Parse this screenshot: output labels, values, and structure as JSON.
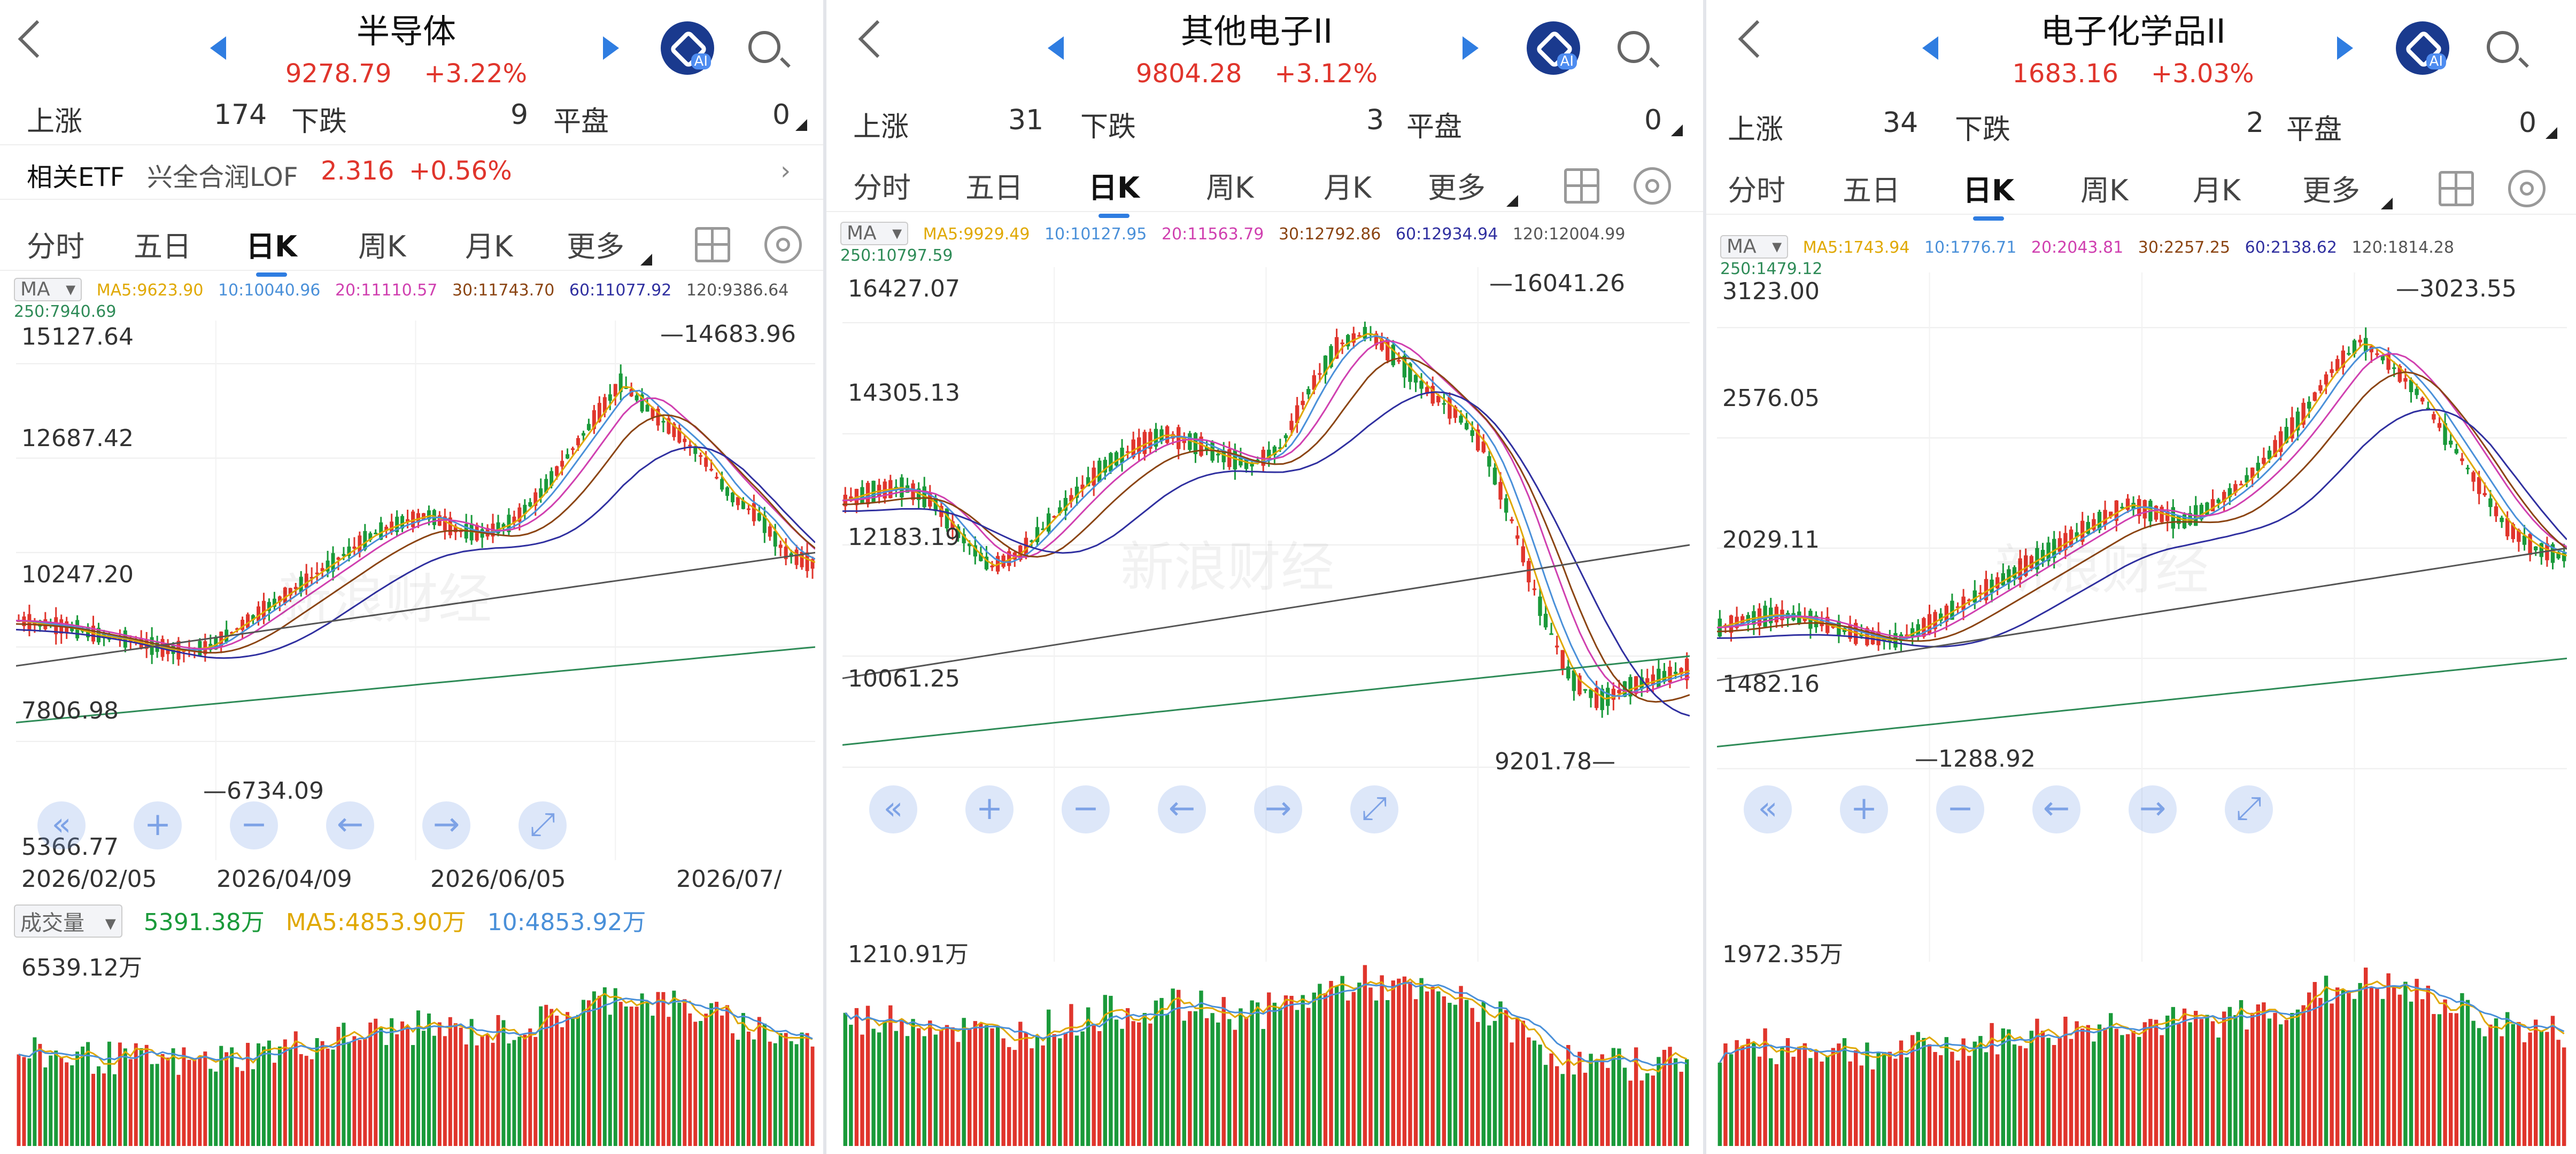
{
  "colors": {
    "up": "#e0352c",
    "down": "#1a9a3a",
    "accent": "#2f7de1",
    "ma5": "#e0a800",
    "ma10": "#4a90d9",
    "ma20": "#d040b0",
    "ma30": "#8b4513",
    "ma60": "#3030a0",
    "ma120": "#555555",
    "ma250": "#2e8b57"
  },
  "panels": [
    {
      "title": "半导体",
      "price": "9278.79",
      "change": "+3.22%",
      "stats": {
        "up_label": "上涨",
        "up": "174",
        "down_label": "下跌",
        "down": "9",
        "flat_label": "平盘",
        "flat": "0"
      },
      "etf": {
        "label": "相关ETF",
        "name": "兴全合润LOF",
        "price": "2.316",
        "change": "+0.56%"
      },
      "tabs": [
        "分时",
        "五日",
        "日K",
        "周K",
        "月K",
        "更多"
      ],
      "active_tab": "日K",
      "ma_button": "MA",
      "ma": [
        "MA5:9623.90",
        "10:10040.96",
        "20:11110.57",
        "30:11743.70",
        "60:11077.92",
        "120:9386.64",
        "250:7940.69"
      ],
      "y_labels": [
        "15127.64",
        "12687.42",
        "10247.20",
        "7806.98",
        "5366.77"
      ],
      "high_label": "14683.96",
      "low_label": "6734.09",
      "dates": [
        "2026/02/05",
        "2026/04/09",
        "2026/06/05",
        "2026/07/"
      ],
      "vol_button": "成交量",
      "vol": [
        "5391.38万",
        "MA5:4853.90万",
        "10:4853.92万"
      ],
      "vol_max": "6539.12万"
    },
    {
      "title": "其他电子II",
      "price": "9804.28",
      "change": "+3.12%",
      "stats": {
        "up_label": "上涨",
        "up": "31",
        "down_label": "下跌",
        "down": "3",
        "flat_label": "平盘",
        "flat": "0"
      },
      "tabs": [
        "分时",
        "五日",
        "日K",
        "周K",
        "月K",
        "更多"
      ],
      "active_tab": "日K",
      "ma_button": "MA",
      "ma": [
        "MA5:9929.49",
        "10:10127.95",
        "20:11563.79",
        "30:12792.86",
        "60:12934.94",
        "120:12004.99",
        "250:10797.59"
      ],
      "y_labels": [
        "16427.07",
        "14305.13",
        "12183.19",
        "10061.25"
      ],
      "high_label": "16041.26",
      "low_label": "9201.78",
      "vol_max": "1210.91万"
    },
    {
      "title": "电子化学品II",
      "price": "1683.16",
      "change": "+3.03%",
      "stats": {
        "up_label": "上涨",
        "up": "34",
        "down_label": "下跌",
        "down": "2",
        "flat_label": "平盘",
        "flat": "0"
      },
      "tabs": [
        "分时",
        "五日",
        "日K",
        "周K",
        "月K",
        "更多"
      ],
      "active_tab": "日K",
      "ma_button": "MA",
      "ma": [
        "MA5:1743.94",
        "10:1776.71",
        "20:2043.81",
        "30:2257.25",
        "60:2138.62",
        "120:1814.28",
        "250:1479.12"
      ],
      "y_labels": [
        "3123.00",
        "2576.05",
        "2029.11",
        "1482.16"
      ],
      "high_label": "3023.55",
      "low_label": "1288.92",
      "vol_max": "1972.35万"
    }
  ],
  "watermark": "新浪财经",
  "tool_icons": [
    "double-left-icon",
    "zoom-in-icon",
    "zoom-out-icon",
    "arrow-left-icon",
    "arrow-right-icon",
    "fullscreen-icon"
  ],
  "tool_glyphs": [
    "«",
    "+",
    "−",
    "←",
    "→",
    "⤢"
  ]
}
